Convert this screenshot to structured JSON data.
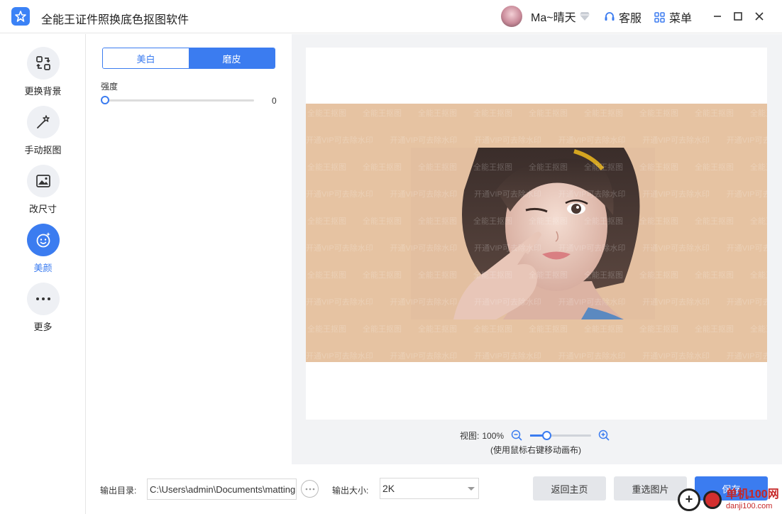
{
  "titlebar": {
    "app_title": "全能王证件照换底色抠图软件",
    "user_name": "Ma~晴天",
    "service_label": "客服",
    "menu_label": "菜单"
  },
  "sidebar": {
    "items": [
      {
        "label": "更换背景",
        "icon": "swap-image-icon"
      },
      {
        "label": "手动抠图",
        "icon": "magic-wand-icon"
      },
      {
        "label": "改尺寸",
        "icon": "resize-image-icon"
      },
      {
        "label": "美颜",
        "icon": "smiley-face-icon",
        "active": true
      },
      {
        "label": "更多",
        "icon": "more-dots-icon"
      }
    ]
  },
  "panel": {
    "tabs": [
      "美白",
      "磨皮"
    ],
    "active_tab": "磨皮",
    "strength_label": "强度",
    "strength_value": "0"
  },
  "preview": {
    "watermark_1": "全能王抠图",
    "watermark_2": "开通VIP可去除水印",
    "background_color": "#e6c3a2"
  },
  "zoom": {
    "label": "视图:",
    "value": "100%",
    "hint": "(使用鼠标右键移动画布)",
    "level": 0.28
  },
  "bottombar": {
    "output_dir_label": "输出目录:",
    "output_dir_value": "C:\\Users\\admin\\Documents\\matting",
    "output_size_label": "输出大小:",
    "output_size_value": "2K",
    "home_button": "返回主页",
    "reselect_button": "重选图片",
    "save_button": "保存"
  },
  "site_watermark": {
    "line1": "单机100网",
    "line2": "danji100.com"
  },
  "colors": {
    "accent": "#3b7cf0"
  }
}
